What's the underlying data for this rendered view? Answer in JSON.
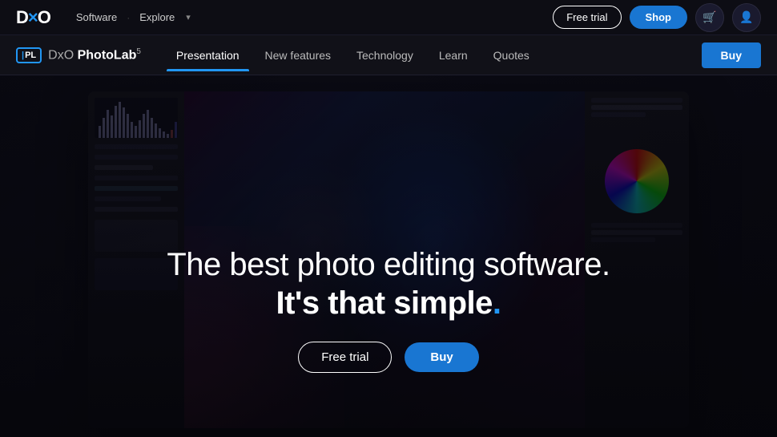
{
  "topNav": {
    "logo": "DXO",
    "links": [
      {
        "label": "Software",
        "id": "software"
      },
      {
        "label": "Explore",
        "id": "explore"
      }
    ],
    "buttons": {
      "freeTrial": "Free trial",
      "shop": "Shop"
    },
    "icons": {
      "cart": "🛒",
      "user": "👤"
    }
  },
  "productNav": {
    "badge": "PL",
    "productPrefix": "DxO",
    "productName": "PhotoLab",
    "superscript": "5",
    "links": [
      {
        "label": "Presentation",
        "active": true
      },
      {
        "label": "New features",
        "active": false
      },
      {
        "label": "Technology",
        "active": false
      },
      {
        "label": "Learn",
        "active": false
      },
      {
        "label": "Quotes",
        "active": false
      }
    ],
    "buyButton": "Buy"
  },
  "hero": {
    "titleLine1": "The best photo editing software.",
    "titleLine2Bold": "It's that simple",
    "titleDot": ".",
    "buttons": {
      "freeTrial": "Free trial",
      "buy": "Buy"
    }
  }
}
